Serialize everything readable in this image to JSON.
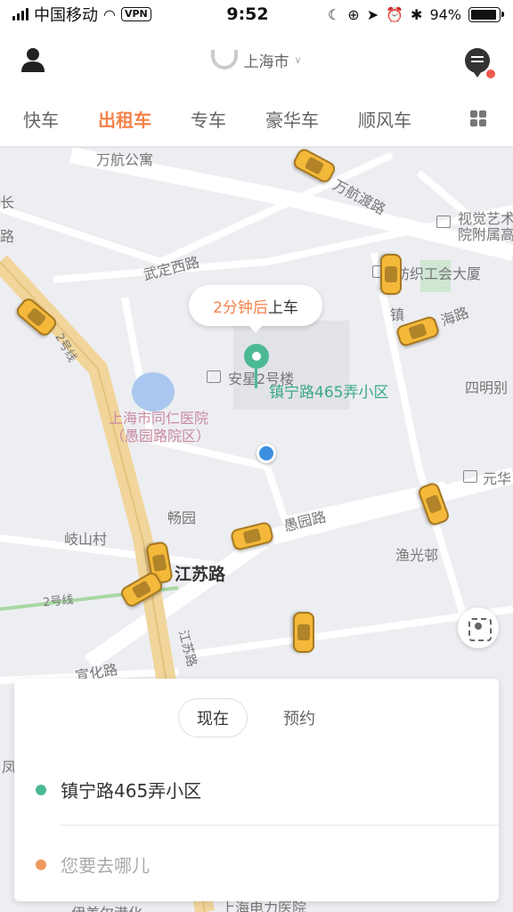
{
  "status_bar": {
    "carrier": "中国移动",
    "vpn": "VPN",
    "time": "9:52",
    "battery_text": "94%",
    "battery_level": 0.94
  },
  "header": {
    "city": "上海市"
  },
  "tabs": [
    {
      "label": "快车",
      "active": false
    },
    {
      "label": "出租车",
      "active": true
    },
    {
      "label": "专车",
      "active": false
    },
    {
      "label": "豪华车",
      "active": false
    },
    {
      "label": "顺风车",
      "active": false
    }
  ],
  "map": {
    "pickup_eta_prefix": "2分钟后",
    "pickup_eta_suffix": "上车",
    "pickup_label": "镇宁路465弄小区",
    "labels": {
      "wanhang_apartment": "万航公寓",
      "wanhang_ferry_rd": "万航渡路",
      "visual_arts": "视觉艺术",
      "visual_arts_2": "院附属高",
      "wuding_west_rd": "武定西路",
      "textile_union": "纺织工会大厦",
      "zhen_char": "镇",
      "hai_rd": "海路",
      "anzhong_bldg": "安星2号楼",
      "tongren_hospital": "上海市同仁医院",
      "tongren_branch": "（愚园路院区）",
      "siming": "四明别",
      "changyuan": "畅园",
      "yuyuan_rd": "愚园路",
      "yuanhua": "元华",
      "qishan_village": "岐山村",
      "yuguang_lane": "渔光邨",
      "jiangsu_rd": "江苏路",
      "line2_a": "2号线",
      "line2_b": "2号线",
      "jiangsu_vertical": "江苏路",
      "xuanhua_rd": "宣化路",
      "chang_char": "长",
      "lu_char": "路",
      "feng": "凤",
      "electric_hospital": "上海电力医院",
      "yishan_rd": "伊美尔港化"
    }
  },
  "card": {
    "now_label": "现在",
    "book_label": "预约",
    "from": "镇宁路465弄小区",
    "to_placeholder": "您要去哪儿"
  }
}
